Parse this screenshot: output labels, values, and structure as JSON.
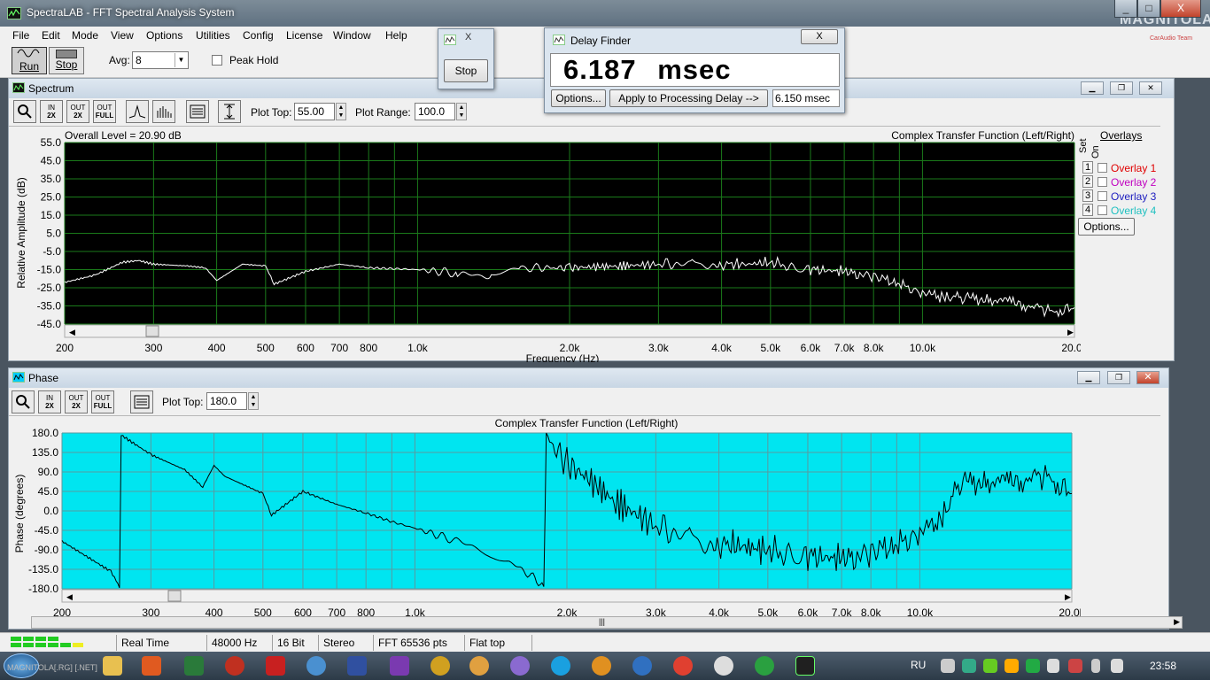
{
  "app": {
    "title": "SpectraLAB - FFT Spectral Analysis System",
    "watermark": "MAGNITOLA",
    "watermark_sub": "CarAudio Team",
    "window_buttons": [
      "_",
      "□",
      "X"
    ]
  },
  "menu": [
    "File",
    "Edit",
    "Mode",
    "View",
    "Options",
    "Utilities",
    "Config",
    "License",
    "Window",
    "Help"
  ],
  "toolbar": {
    "run_label": "Run",
    "stop_label": "Stop",
    "avg_label": "Avg:",
    "avg_value": "8",
    "peak_hold_label": "Peak Hold",
    "peak_hold_checked": false
  },
  "stop_dialog": {
    "close": "X",
    "stop_label": "Stop"
  },
  "delay_finder": {
    "title": "Delay Finder",
    "close": "X",
    "value": "6.187",
    "unit": "msec",
    "options_label": "Options...",
    "apply_label": "Apply to Processing Delay -->",
    "processing_delay": "6.150 msec"
  },
  "spectrum": {
    "title": "Spectrum",
    "plot_top_label": "Plot Top:",
    "plot_top_value": "55.00",
    "plot_range_label": "Plot Range:",
    "plot_range_value": "100.0",
    "overall_level": "Overall Level = 20.90 dB",
    "plot_title": "Complex Transfer Function (Left/Right)",
    "overlays_title": "Overlays",
    "set_label": "Set",
    "on_label": "On",
    "overlays": [
      {
        "num": "1",
        "label": "Overlay 1",
        "color": "#e00000"
      },
      {
        "num": "2",
        "label": "Overlay 2",
        "color": "#c000c0"
      },
      {
        "num": "3",
        "label": "Overlay 3",
        "color": "#2020c0"
      },
      {
        "num": "4",
        "label": "Overlay 4",
        "color": "#20c0c0"
      }
    ],
    "overlay_options": "Options...",
    "icons": [
      "zoom-icon",
      "zoom-in-2x-icon",
      "zoom-out-2x-icon",
      "zoom-out-full-icon",
      "line-plot-icon",
      "bar-plot-icon",
      "list-icon",
      "scale-icon"
    ],
    "icon_labels": [
      {
        "top": "IN",
        "bot": "2X"
      },
      {
        "top": "OUT",
        "bot": "2X"
      },
      {
        "top": "OUT",
        "bot": "FULL"
      }
    ]
  },
  "phase": {
    "title": "Phase",
    "plot_top_label": "Plot Top:",
    "plot_top_value": "180.0",
    "plot_title": "Complex Transfer Function (Left/Right)"
  },
  "chart_data": [
    {
      "type": "line",
      "title": "Complex Transfer Function (Left/Right)",
      "xlabel": "Frequency (Hz)",
      "ylabel": "Relative Amplitude (dB)",
      "x_scale": "log",
      "xlim": [
        200,
        20000
      ],
      "ylim": [
        -45,
        55
      ],
      "x_ticks": [
        "200",
        "300",
        "400",
        "500",
        "600",
        "700",
        "800",
        "1.0k",
        "2.0k",
        "3.0k",
        "4.0k",
        "5.0k",
        "6.0k",
        "7.0k",
        "8.0k",
        "10.0k",
        "20.0k"
      ],
      "y_ticks": [
        "55.0",
        "45.0",
        "35.0",
        "25.0",
        "15.0",
        "5.0",
        "-5.0",
        "-15.0",
        "-25.0",
        "-35.0",
        "-45.0"
      ],
      "grid": true,
      "background": "#000000",
      "grid_color": "#1a7a1a",
      "line_color": "#ffffff",
      "series": [
        {
          "x": [
            200,
            230,
            260,
            280,
            300,
            350,
            380,
            400,
            450,
            500,
            520,
            600,
            700,
            800,
            1000,
            1200,
            1350,
            1400,
            1600,
            2000,
            2500,
            3000,
            3500,
            4000,
            4500,
            5000,
            5500,
            6000,
            7000,
            8000,
            9000,
            10000,
            12000,
            15000,
            18000,
            20000
          ],
          "y": [
            -22,
            -18,
            -11,
            -10,
            -12,
            -13,
            -14,
            -21,
            -12,
            -13,
            -23,
            -16,
            -12,
            -14,
            -15,
            -17,
            -19,
            -17,
            -14,
            -14,
            -13,
            -12,
            -11,
            -12,
            -12,
            -11,
            -13,
            -15,
            -16,
            -19,
            -23,
            -29,
            -31,
            -33,
            -38,
            -36
          ]
        }
      ]
    },
    {
      "type": "line",
      "title": "Complex Transfer Function (Left/Right)",
      "xlabel": "",
      "ylabel": "Phase (degrees)",
      "x_scale": "log",
      "xlim": [
        200,
        20000
      ],
      "ylim": [
        -180,
        180
      ],
      "x_ticks": [
        "200",
        "300",
        "400",
        "500",
        "600",
        "700",
        "800",
        "1.0k",
        "2.0k",
        "3.0k",
        "4.0k",
        "5.0k",
        "6.0k",
        "7.0k",
        "8.0k",
        "10.0k",
        "20.0k"
      ],
      "y_ticks": [
        "180.0",
        "135.0",
        "90.0",
        "45.0",
        "0.0",
        "-45.0",
        "-90.0",
        "-135.0",
        "-180.0"
      ],
      "grid": true,
      "background": "#00e5f0",
      "grid_color": "#5a9aa0",
      "line_color": "#000000",
      "series": [
        {
          "x": [
            200,
            220,
            250,
            260,
            262,
            300,
            350,
            380,
            400,
            420,
            500,
            520,
            600,
            700,
            800,
            900,
            1000,
            1100,
            1300,
            1500,
            1700,
            1800,
            1820,
            2000,
            2200,
            2500,
            3000,
            3500,
            4000,
            5000,
            6000,
            7000,
            8000,
            9000,
            10000,
            11000,
            12000,
            15000,
            18000,
            20000
          ],
          "y": [
            -70,
            -100,
            -140,
            -175,
            175,
            130,
            95,
            55,
            105,
            80,
            40,
            -10,
            45,
            15,
            -5,
            -25,
            -40,
            -55,
            -80,
            -110,
            -150,
            -175,
            170,
            110,
            75,
            20,
            -35,
            -55,
            -75,
            -90,
            -105,
            -110,
            -100,
            -80,
            -60,
            -20,
            60,
            65,
            80,
            40
          ]
        }
      ]
    }
  ],
  "status": {
    "mode": "Real Time",
    "rate": "48000 Hz",
    "bits": "16 Bit",
    "channels": "Stereo",
    "fft": "FFT 65536 pts",
    "window": "Flat top"
  },
  "taskbar": {
    "lang": "RU",
    "time": "23:58",
    "left_text": "MAGNITOLA[.RG] [.NET]"
  }
}
